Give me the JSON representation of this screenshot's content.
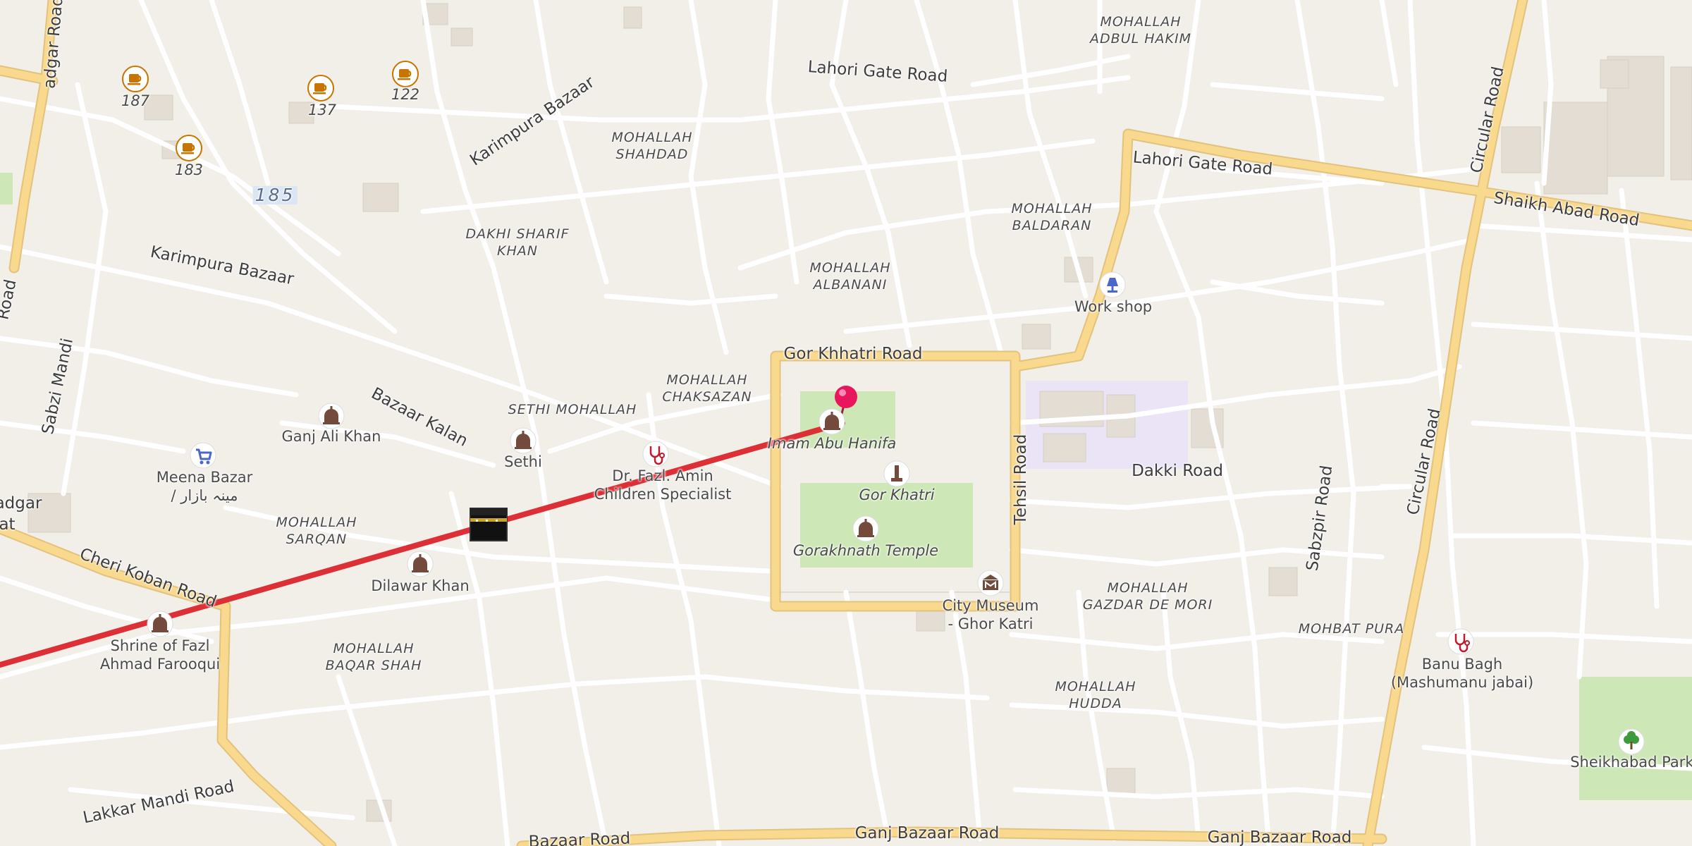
{
  "map": {
    "accent_route_color": "#dd3036",
    "marker_color": "#e8175d",
    "major_road_color": "#f8d98d",
    "park_color": "#cde8b6",
    "institution_color": "#ebe4f7"
  },
  "streets": {
    "lahori_gate_1": "Lahori Gate Road",
    "lahori_gate_2": "Lahori Gate Road",
    "shaikh_abad": "Shaikh Abad Road",
    "circular_1": "Circular Road",
    "circular_2": "Circular Road",
    "karimpura_1": "Karimpura Bazaar",
    "karimpura_2": "Karimpura Bazaar",
    "bazaar_kalan": "Bazaar Kalan",
    "gor_khhatri": "Gor Khhatri Road",
    "tehsil": "Tehsil Road",
    "dakki": "Dakki Road",
    "sabzpir": "Sabzpir Road",
    "cheri_koban": "Cheri Koban Road",
    "lakkar_mandi": "Lakkar Mandi Road",
    "ganj_bazaar_1": "Ganj Bazaar Road",
    "ganj_bazaar_2": "Ganj Bazaar Road",
    "bazaar_partial": "Bazaar Road",
    "sabzi_mandi": "Sabzi Mandi",
    "adgar_partial": "adgar Road",
    "edge_left_partial": "Road",
    "edge_adgar": "adgar",
    "edge_at": "at"
  },
  "areas": {
    "adbul_hakim": [
      "MOHALLAH",
      "ADBUL HAKIM"
    ],
    "shahdad": [
      "MOHALLAH",
      "SHAHDAD"
    ],
    "baldaran": [
      "MOHALLAH",
      "BALDARAN"
    ],
    "dakhi": [
      "DAKHI SHARIF",
      "KHAN"
    ],
    "albanani": [
      "MOHALLAH",
      "ALBANANI"
    ],
    "chaksazan": [
      "MOHALLAH",
      "CHAKSAZAN"
    ],
    "sethi_mohallah": "SETHI MOHALLAH",
    "sarqan": [
      "MOHALLAH",
      "SARQAN"
    ],
    "baqar_shah": [
      "MOHALLAH",
      "BAQAR SHAH"
    ],
    "gazdar": [
      "MOHALLAH",
      "GAZDAR DE MORI"
    ],
    "mohbat": "MOHBAT PURA",
    "hudda": [
      "MOHALLAH",
      "HUDDA"
    ]
  },
  "pois": {
    "cafe_187": "187",
    "cafe_137": "137",
    "cafe_122": "122",
    "cafe_183": "183",
    "shop_185": "185",
    "ganj_ali_khan": "Ganj Ali Khan",
    "meena_bazar": [
      "Meena Bazar",
      "/ مینہ بازار"
    ],
    "sethi": "Sethi",
    "dr_fazl": [
      "Dr. Fazl. Amin",
      "Children Specialist"
    ],
    "imam_abu_hanifa": "Imam Abu Hanifa",
    "gor_khatri": "Gor Khatri",
    "gorakhnath": "Gorakhnath Temple",
    "city_museum": [
      "City Museum",
      "- Ghor Katri"
    ],
    "work_shop": "Work shop",
    "dilawar_khan": "Dilawar Khan",
    "shrine": [
      "Shrine of Fazl",
      "Ahmad Farooqui"
    ],
    "banu_bagh": [
      "Banu Bagh",
      "(Mashumanu jabai)"
    ],
    "sheikhabad_park": "Sheikhabad Park -"
  },
  "icons": {
    "cafe": "coffee-cup-icon",
    "mosque": "mosque-icon",
    "shop": "shopping-cart-icon",
    "doctor": "stethoscope-icon",
    "monument": "monument-icon",
    "museum": "museum-icon",
    "workshop": "lamp-icon",
    "park": "tree-icon",
    "kaaba": "kaaba-icon",
    "marker": "map-pin-icon"
  }
}
